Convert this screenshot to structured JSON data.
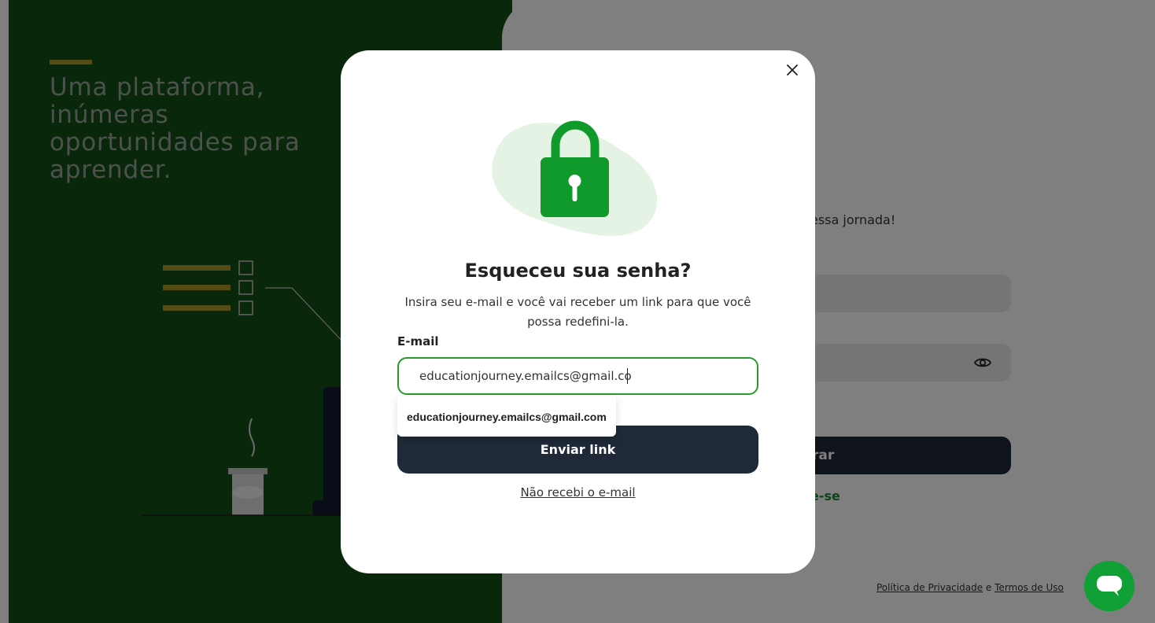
{
  "hero": {
    "tagline": "Uma plataforma, inúmeras oportunidades para aprender."
  },
  "login_background": {
    "subtitle_fragment": "essa jornada!",
    "button_fragment": "rar",
    "signup_fragment": "e-se",
    "footer": {
      "privacy_label": "Política de Privacidade",
      "separator": "e",
      "terms_label": "Termos de Uso"
    }
  },
  "modal": {
    "title": "Esqueceu sua senha?",
    "description": "Insira seu e-mail e você vai receber um link para que você possa redefini-la.",
    "email_label": "E-mail",
    "email_value": "educationjourney.emailcs@gmail.co",
    "autocomplete_suggestion": "educationjourney.emailcs@gmail.com",
    "submit_label": "Enviar link",
    "resend_label": "Não recebi o e-mail"
  },
  "colors": {
    "hero_green": "#124f17",
    "accent_gold": "#a8962a",
    "brand_green": "#10a035",
    "dark_button": "#1f2937",
    "input_border": "#2a9a2e"
  },
  "icons": {
    "close": "close-icon",
    "lock": "lock-icon",
    "eye": "eye-icon",
    "chat": "chat-bubble-icon"
  }
}
